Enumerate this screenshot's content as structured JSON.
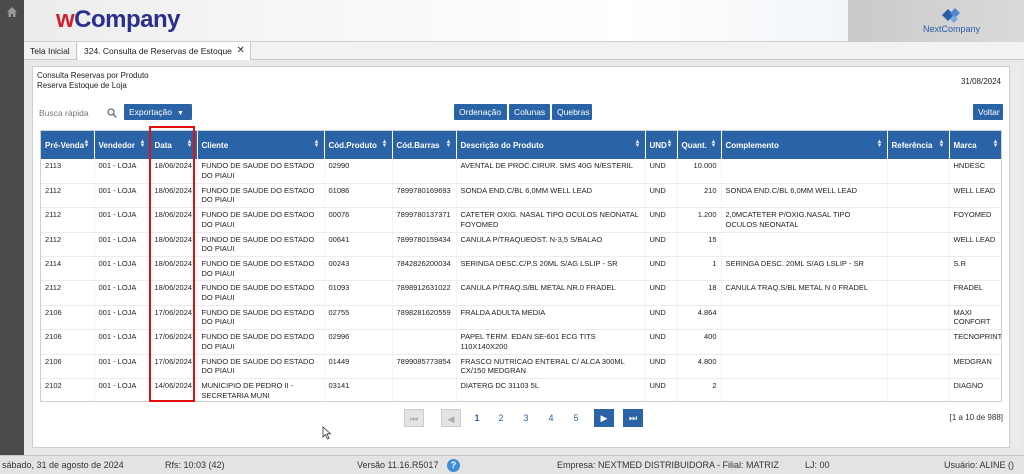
{
  "brand": {
    "logo_w": "w",
    "logo_rest": "Company",
    "partner": "NextCompany"
  },
  "tabs": [
    {
      "label": "Tela Inicial"
    },
    {
      "label": "324. Consulta de Reservas de Estoque"
    }
  ],
  "panel": {
    "title1": "Consulta Reservas por Produto",
    "title2": "Reserva Estoque de Loja",
    "date": "31/08/2024"
  },
  "toolbar": {
    "search_placeholder": "Busca rápida",
    "export_label": "Exportação",
    "order_label": "Ordenação",
    "columns_label": "Colunas",
    "breaks_label": "Quebras",
    "back_label": "Voltar"
  },
  "table": {
    "columns": [
      "Pré-Venda",
      "Vendedor",
      "Data",
      "Cliente",
      "Cód.Produto",
      "Cód.Barras",
      "Descrição do Produto",
      "UND",
      "Quant.",
      "Complemento",
      "Referência",
      "Marca"
    ],
    "rows": [
      [
        "2113",
        "001 - LOJA",
        "18/06/2024",
        "FUNDO DE SAUDE DO ESTADO DO PIAUI",
        "02990",
        "",
        "AVENTAL DE PROC.CIRUR. SMS 40G N/ESTERIL",
        "UND",
        "10.000",
        "",
        "",
        "HNDESC"
      ],
      [
        "2112",
        "001 - LOJA",
        "18/06/2024",
        "FUNDO DE SAUDE DO ESTADO DO PIAUI",
        "01086",
        "7899780169693",
        "SONDA END.C/BL 6,0MM WELL LEAD",
        "UND",
        "210",
        "SONDA END.C/BL 6,0MM WELL LEAD",
        "",
        "WELL LEAD"
      ],
      [
        "2112",
        "001 - LOJA",
        "18/06/2024",
        "FUNDO DE SAUDE DO ESTADO DO PIAUI",
        "00076",
        "7899780137371",
        "CATETER OXIG. NASAL TIPO OCULOS NEONATAL FOYOMED",
        "UND",
        "1.200",
        "2,0MCATETER P/OXIG.NASAL TIPO OCULOS NEONATAL",
        "",
        "FOYOMED"
      ],
      [
        "2112",
        "001 - LOJA",
        "18/06/2024",
        "FUNDO DE SAUDE DO ESTADO DO PIAUI",
        "00641",
        "7899780159434",
        "CANULA P/TRAQUEOST. N-3,5 S/BALAO",
        "UND",
        "15",
        "",
        "",
        "WELL LEAD"
      ],
      [
        "2114",
        "001 - LOJA",
        "18/06/2024",
        "FUNDO DE SAUDE DO ESTADO DO PIAUI",
        "00243",
        "7842826200034",
        "SERINGA DESC.C/P.S 20ML S/AG LSLIP - SR",
        "UND",
        "1",
        "SERINGA DESC. 20ML S/AG LSLIP - SR",
        "",
        "S.R"
      ],
      [
        "2112",
        "001 - LOJA",
        "18/06/2024",
        "FUNDO DE SAUDE DO ESTADO DO PIAUI",
        "01093",
        "7898912631022",
        "CANULA P/TRAQ.S/BL METAL NR.0 FRADEL",
        "UND",
        "18",
        "CANULA TRAQ.S/BL METAL N 0 FRADEL",
        "",
        "FRADEL"
      ],
      [
        "2106",
        "001 - LOJA",
        "17/06/2024",
        "FUNDO DE SAUDE DO ESTADO DO PIAUI",
        "02755",
        "7898281620559",
        "FRALDA ADULTA MEDIA",
        "UND",
        "4.864",
        "",
        "",
        "MAXI CONFORT"
      ],
      [
        "2106",
        "001 - LOJA",
        "17/06/2024",
        "FUNDO DE SAUDE DO ESTADO DO PIAUI",
        "02996",
        "",
        "PAPEL TERM. EDAN SE-601 ECG TITS 110X140X200",
        "UND",
        "400",
        "",
        "",
        "TECNOPRINT"
      ],
      [
        "2106",
        "001 - LOJA",
        "17/06/2024",
        "FUNDO DE SAUDE DO ESTADO DO PIAUI",
        "01449",
        "7899085773854",
        "FRASCO NUTRICAO ENTERAL C/ ALCA 300ML CX/150 MEDGRAN",
        "UND",
        "4.800",
        "",
        "",
        "MEDGRAN"
      ],
      [
        "2102",
        "001 - LOJA",
        "14/06/2024",
        "MUNICIPIO DE PEDRO II - SECRETARIA MUNI",
        "03141",
        "",
        "DIATERG DC 31103 5L",
        "UND",
        "2",
        "",
        "",
        "DIAGNO"
      ]
    ]
  },
  "pager": {
    "pages": [
      "1",
      "2",
      "3",
      "4",
      "5"
    ],
    "current": "1",
    "info": "[1 a 10 de 988]"
  },
  "status": {
    "datetime": "sábado, 31 de agosto de 2024",
    "rfs": "Rfs: 10:03 (42)",
    "version": "Versão 11.16.R5017",
    "company": "Empresa: NEXTMED DISTRIBUIDORA - Filial: MATRIZ",
    "lj": "LJ: 00",
    "user": "Usuário: ALINE ()"
  },
  "highlight_color": "#e01010",
  "accent_color": "#2a63a6"
}
